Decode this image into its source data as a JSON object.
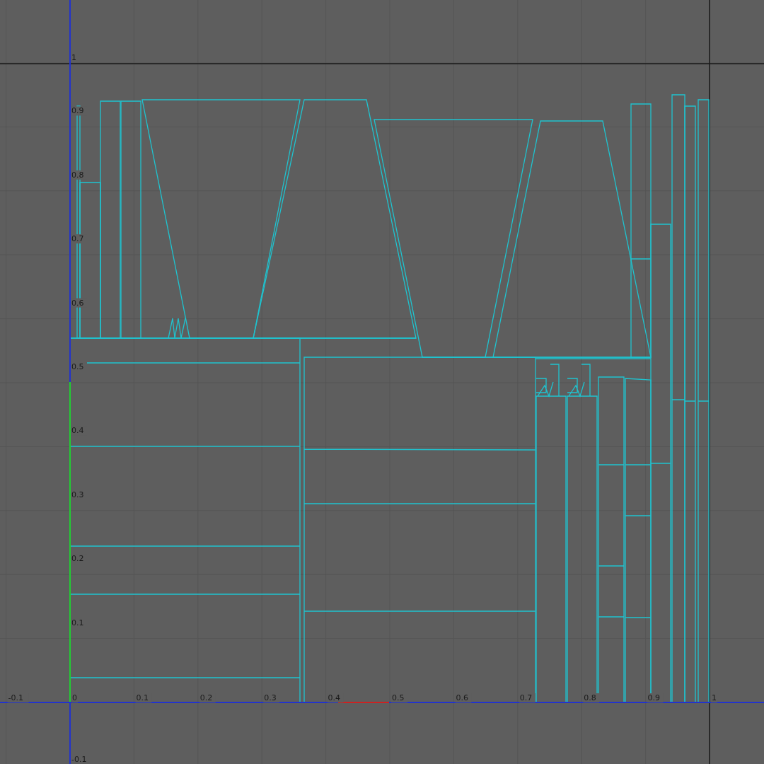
{
  "uv_editor": {
    "x_labels": [
      "-0.1",
      "0",
      "0.1",
      "0.2",
      "0.3",
      "0.4",
      "0.5",
      "0.6",
      "0.7",
      "0.8",
      "0.9",
      "1"
    ],
    "y_labels": [
      "1",
      "0.9",
      "0.8",
      "0.7",
      "0.6",
      "0.5",
      "0.4",
      "0.3",
      "0.2",
      "0.1"
    ],
    "y_negative_label": "-0.1"
  }
}
